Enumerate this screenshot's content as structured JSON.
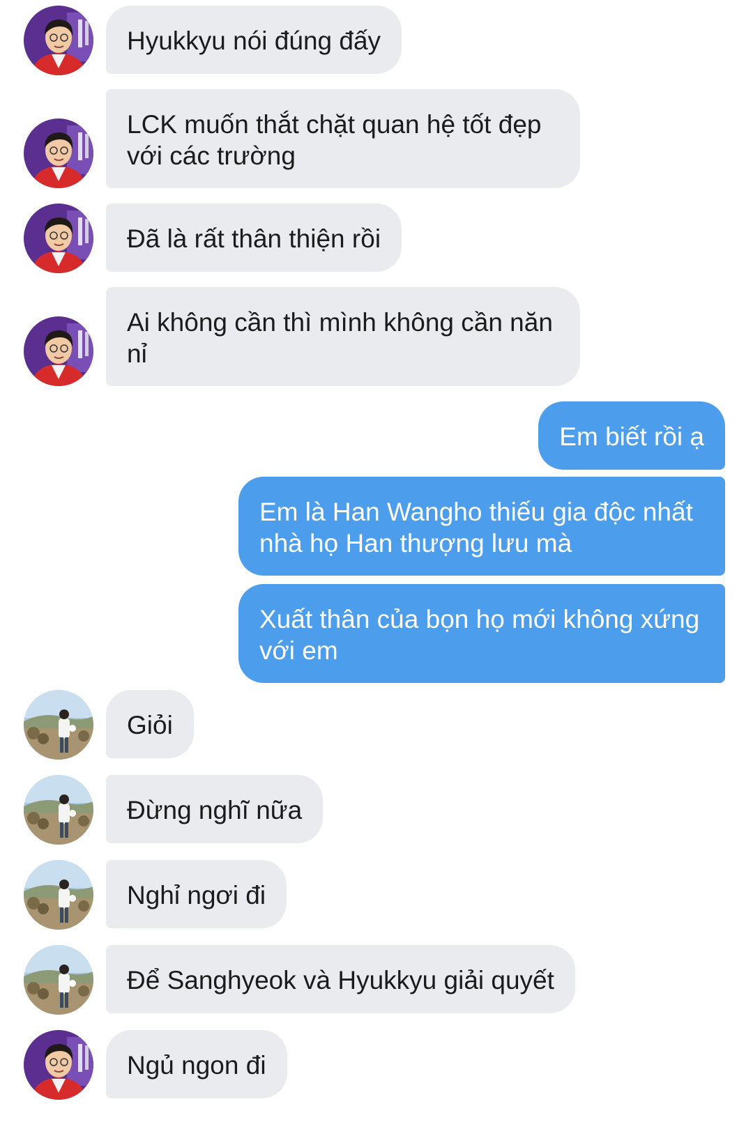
{
  "avatars": {
    "contact_a": "avatar-red-jacket",
    "contact_b": "avatar-field-photo"
  },
  "colors": {
    "incoming_bubble": "#e9ebef",
    "outgoing_bubble": "#4c9eec",
    "incoming_text": "#1b1b1b",
    "outgoing_text": "#ffffff"
  },
  "messages": [
    {
      "sender": "contact_a",
      "direction": "in",
      "text": "Hyukkyu nói đúng đấy"
    },
    {
      "sender": "contact_a",
      "direction": "in",
      "text": "LCK muốn thắt chặt quan hệ tốt đẹp với các trường"
    },
    {
      "sender": "contact_a",
      "direction": "in",
      "text": "Đã là rất thân thiện rồi"
    },
    {
      "sender": "contact_a",
      "direction": "in",
      "text": "Ai không cần thì mình không cần năn nỉ"
    },
    {
      "sender": "me",
      "direction": "out",
      "text": "Em biết rồi ạ"
    },
    {
      "sender": "me",
      "direction": "out",
      "text": "Em là Han Wangho thiếu gia độc nhất nhà họ Han thượng lưu mà"
    },
    {
      "sender": "me",
      "direction": "out",
      "text": "Xuất thân của bọn họ mới không xứng với em"
    },
    {
      "sender": "contact_b",
      "direction": "in",
      "text": "Giỏi"
    },
    {
      "sender": "contact_b",
      "direction": "in",
      "text": "Đừng nghĩ nữa"
    },
    {
      "sender": "contact_b",
      "direction": "in",
      "text": "Nghỉ ngơi đi"
    },
    {
      "sender": "contact_b",
      "direction": "in",
      "text": "Để Sanghyeok và Hyukkyu giải quyết"
    },
    {
      "sender": "contact_a",
      "direction": "in",
      "text": "Ngủ ngon đi"
    }
  ]
}
